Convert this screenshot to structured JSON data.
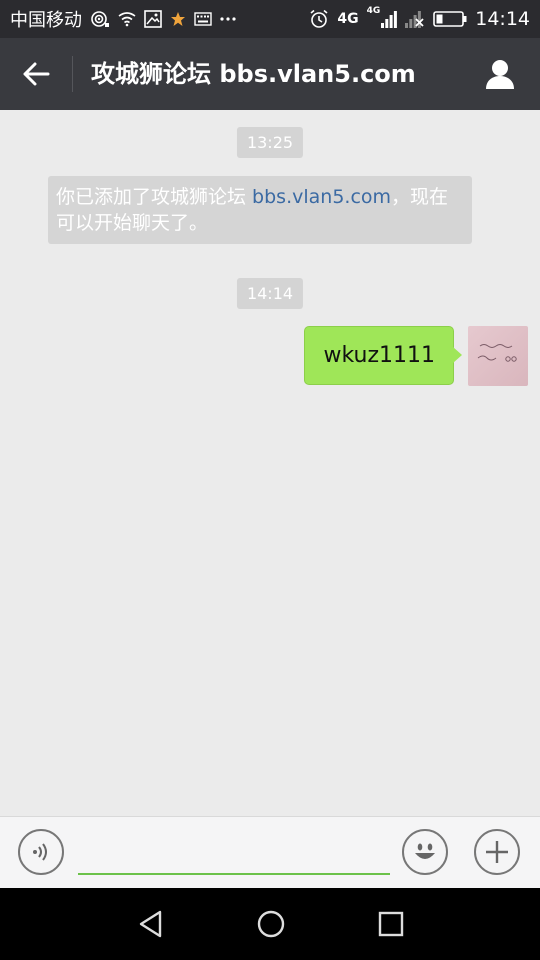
{
  "status_bar": {
    "carrier": "中国移动",
    "network_4g_large": "4G",
    "network_4g_small": "4G",
    "time": "14:14",
    "icons": [
      "hotspot-icon",
      "wifi-icon",
      "gallery-icon",
      "star-icon",
      "keyboard-icon",
      "more-icon",
      "alarm-icon",
      "signal-icon",
      "signal-off-icon",
      "battery-icon"
    ]
  },
  "header": {
    "title": "攻城狮论坛 bbs.vlan5.com",
    "back_icon": "arrow-left-icon",
    "profile_icon": "person-icon"
  },
  "chat": {
    "timestamps": [
      "13:25",
      "14:14"
    ],
    "system_message": {
      "prefix": "你已添加了攻城狮论坛 ",
      "link": "bbs.vlan5.com",
      "suffix": "，现在可以开始聊天了。"
    },
    "messages": [
      {
        "sender": "me",
        "text": "wkuz1111"
      }
    ]
  },
  "input_bar": {
    "value": "",
    "voice_icon": "voice-icon",
    "emoji_icon": "smiley-icon",
    "plus_icon": "plus-icon"
  },
  "nav_bar": {
    "icons": [
      "back-triangle-icon",
      "home-circle-icon",
      "recents-square-icon"
    ]
  },
  "colors": {
    "title_bar": "#393a3f",
    "status_bar": "#2b2b2f",
    "chat_background": "#ebebeb",
    "bubble_green": "#9fe658",
    "link_blue": "#3b6aa3",
    "input_underline": "#6cc24a"
  }
}
